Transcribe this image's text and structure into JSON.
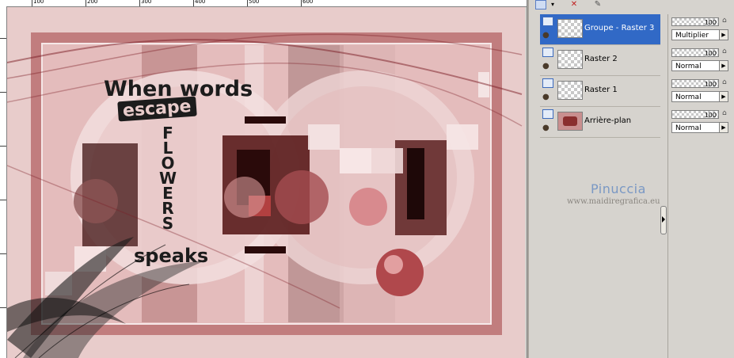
{
  "ruler": {
    "labels": [
      "100",
      "200",
      "300",
      "400",
      "500",
      "600"
    ]
  },
  "artwork": {
    "line1": "When words",
    "line2": "escape",
    "vertical_word": "FLOWERS",
    "line3": "speaks"
  },
  "layers_toolbar": {
    "icons": [
      "new-layer-icon",
      "dropdown-arrow-icon",
      "delete-layer-icon",
      "layer-properties-icon"
    ]
  },
  "layers": [
    {
      "name": "Groupe - Raster 3",
      "selected": true,
      "opacity": "100",
      "blend": "Multiplier"
    },
    {
      "name": "Raster 2",
      "selected": false,
      "opacity": "100",
      "blend": "Normal"
    },
    {
      "name": "Raster 1",
      "selected": false,
      "opacity": "100",
      "blend": "Normal"
    },
    {
      "name": "Arrière-plan",
      "selected": false,
      "opacity": "100",
      "blend": "Normal"
    }
  ],
  "watermark": {
    "name": "Pinuccia",
    "url": "www.maidiregrafica.eu"
  },
  "colors": {
    "selection": "#3169c6",
    "canvas_pink": "#e8cccb",
    "dark_red": "#8a2e2e"
  }
}
